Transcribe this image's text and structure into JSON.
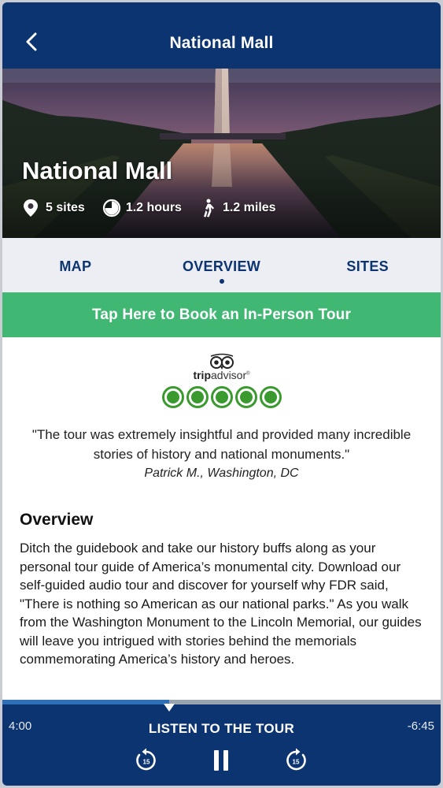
{
  "header": {
    "title": "National Mall",
    "back_icon": "chevron-left-icon"
  },
  "hero": {
    "title": "National Mall",
    "stats": [
      {
        "icon": "map-pin-icon",
        "text": "5 sites"
      },
      {
        "icon": "clock-icon",
        "text": "1.2 hours"
      },
      {
        "icon": "walking-icon",
        "text": "1.2 miles"
      }
    ]
  },
  "tabs": {
    "map": "MAP",
    "overview": "OVERVIEW",
    "sites": "SITES",
    "active": "OVERVIEW"
  },
  "book_button": {
    "label": "Tap Here to Book an In-Person Tour",
    "color": "#40b874"
  },
  "review": {
    "brand_prefix": "trip",
    "brand_suffix": "advisor",
    "rating": 5,
    "rating_max": 5,
    "quote": "\"The tour was extremely insightful and provided many incredible stories of history and national monuments.\"",
    "author": "Patrick M., Washington, DC"
  },
  "overview": {
    "heading": "Overview",
    "body": "Ditch the guidebook and take our history buffs along as your personal tour guide of America’s monumental city. Download our self-guided audio tour and discover for yourself why FDR said, \"There is nothing so American as our national parks.\" As you walk from the Washington Monument to the Lincoln Memorial, our guides will leave you intrigued with stories behind the memorials commemorating America’s history and heroes."
  },
  "player": {
    "elapsed": "4:00",
    "remaining": "-6:45",
    "label": "LISTEN TO THE TOUR",
    "progress": 0.38,
    "rewind_seconds": "15",
    "forward_seconds": "15"
  },
  "colors": {
    "primary": "#0b3470",
    "accent_green": "#40b874",
    "ta_green": "#3a9a2f"
  }
}
